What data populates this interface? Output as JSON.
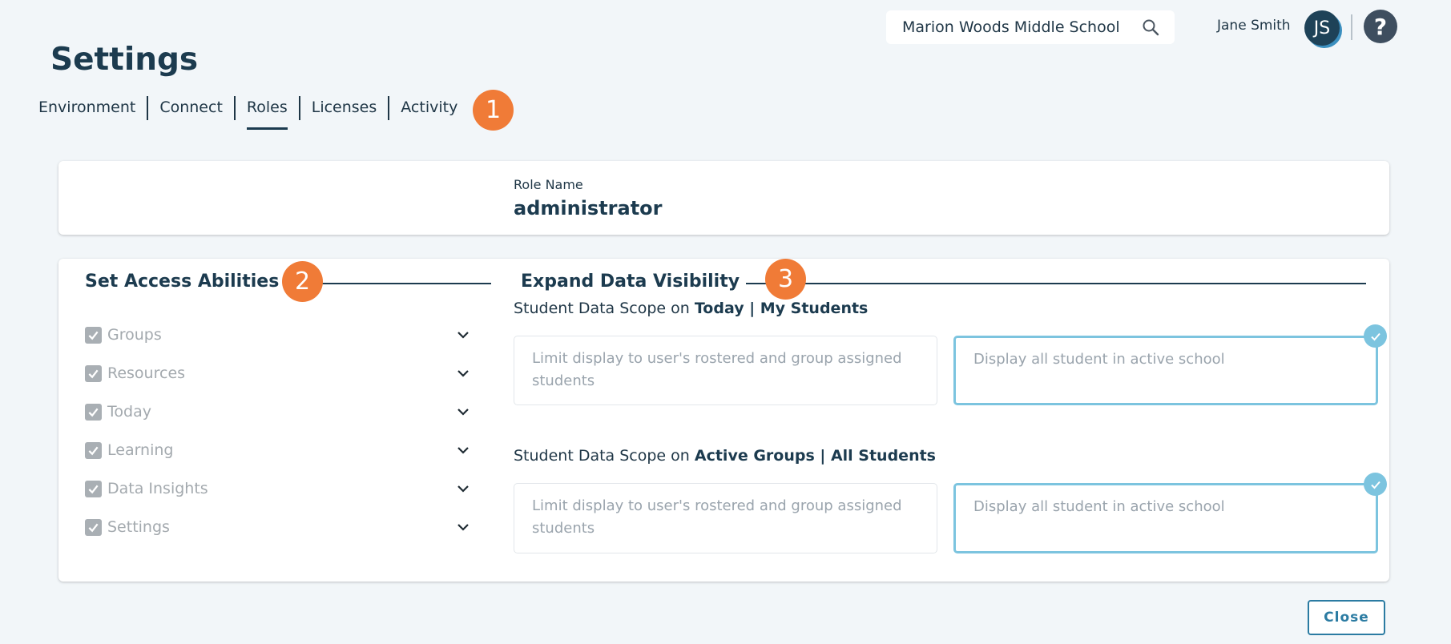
{
  "header": {
    "school": "Marion Woods Middle School",
    "user_name": "Jane Smith",
    "avatar_initials": "JS",
    "help_symbol": "?"
  },
  "page": {
    "title": "Settings"
  },
  "tabs": [
    {
      "label": "Environment",
      "active": false
    },
    {
      "label": "Connect",
      "active": false
    },
    {
      "label": "Roles",
      "active": true
    },
    {
      "label": "Licenses",
      "active": false
    },
    {
      "label": "Activity",
      "active": false
    }
  ],
  "badges": [
    "1",
    "2",
    "3"
  ],
  "role": {
    "label": "Role Name",
    "value": "administrator"
  },
  "access": {
    "title": "Set Access Abilities",
    "items": [
      "Groups",
      "Resources",
      "Today",
      "Learning",
      "Data Insights",
      "Settings"
    ]
  },
  "visibility": {
    "title": "Expand Data Visibility",
    "scopes": [
      {
        "prefix": "Student Data Scope on ",
        "bold": "Today | My Students",
        "option_limited": "Limit display to user's rostered and group assigned students",
        "option_all": "Display all student in active school",
        "selected": "all"
      },
      {
        "prefix": "Student Data Scope on ",
        "bold": "Active Groups | All Students",
        "option_limited": "Limit display to user's rostered and group assigned students",
        "option_all": "Display all student in active school",
        "selected": "all"
      }
    ]
  },
  "footer": {
    "close_label": "Close"
  },
  "colors": {
    "accent_orange": "#f07b37",
    "primary_navy": "#1c3b4f",
    "selected_blue": "#7cc4df",
    "button_blue": "#2b7ba2",
    "background": "#f2f6f9"
  }
}
